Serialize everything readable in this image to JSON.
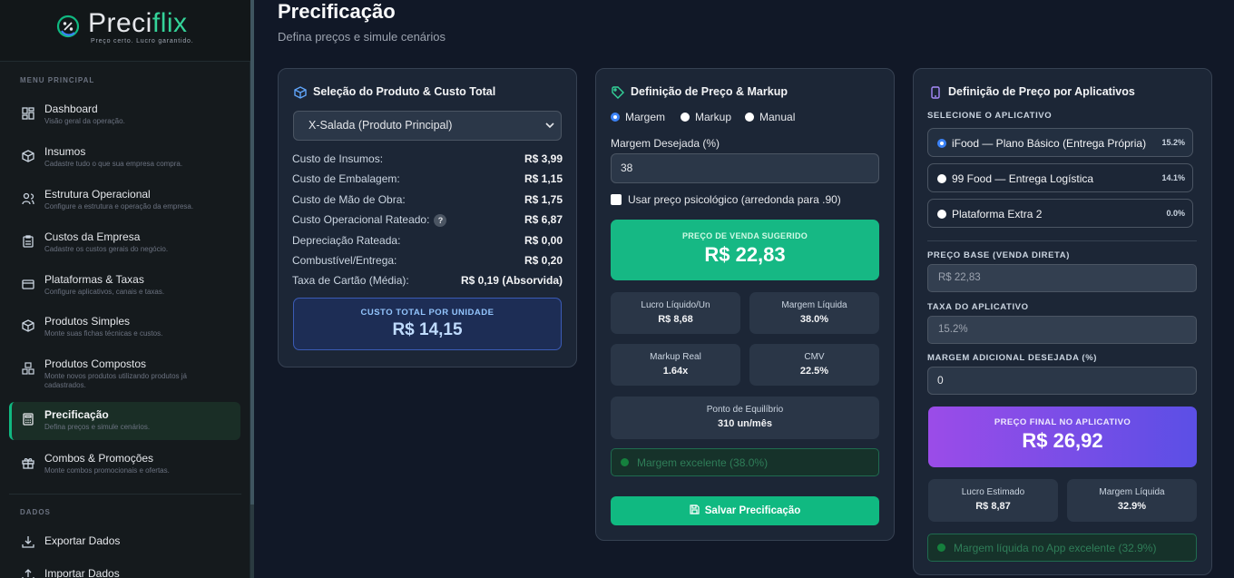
{
  "brand": {
    "name_a": "Preci",
    "name_b": "flix",
    "tagline": "Preço certo. Lucro garantido.",
    "accent": "#10b981"
  },
  "sidebar": {
    "section_main": "MENU PRINCIPAL",
    "section_data": "DADOS",
    "items": [
      {
        "title": "Dashboard",
        "desc": "Visão geral da operação.",
        "icon": "dashboard-icon"
      },
      {
        "title": "Insumos",
        "desc": "Cadastre tudo o que sua empresa compra.",
        "icon": "cube-icon"
      },
      {
        "title": "Estrutura Operacional",
        "desc": "Configure a estrutura e operação da empresa.",
        "icon": "people-icon"
      },
      {
        "title": "Custos da Empresa",
        "desc": "Cadastre os custos gerais do negócio.",
        "icon": "clipboard-icon"
      },
      {
        "title": "Plataformas & Taxas",
        "desc": "Configure aplicativos, canais e taxas.",
        "icon": "card-icon"
      },
      {
        "title": "Produtos Simples",
        "desc": "Monte suas fichas técnicas e custos.",
        "icon": "box-icon"
      },
      {
        "title": "Produtos Compostos",
        "desc": "Monte novos produtos utilizando produtos já cadastrados.",
        "icon": "boxes-icon"
      },
      {
        "title": "Precificação",
        "desc": "Defina preços e simule cenários.",
        "icon": "calculator-icon",
        "active": true
      },
      {
        "title": "Combos & Promoções",
        "desc": "Monte combos promocionais e ofertas.",
        "icon": "gift-icon"
      }
    ],
    "data_items": [
      {
        "title": "Exportar Dados",
        "icon": "download-icon"
      },
      {
        "title": "Importar Dados",
        "icon": "upload-icon"
      }
    ]
  },
  "page": {
    "title": "Precificação",
    "subtitle": "Defina preços e simule cenários"
  },
  "product_card": {
    "title": "Seleção do Produto & Custo Total",
    "selected_product": "X-Salada (Produto Principal)",
    "rows": [
      {
        "label": "Custo de Insumos:",
        "value": "R$ 3,99"
      },
      {
        "label": "Custo de Embalagem:",
        "value": "R$ 1,15"
      },
      {
        "label": "Custo de Mão de Obra:",
        "value": "R$ 1,75"
      },
      {
        "label": "Custo Operacional Rateado:",
        "value": "R$ 6,87",
        "help": "?"
      },
      {
        "label": "Depreciação Rateada:",
        "value": "R$ 0,00"
      },
      {
        "label": "Combustível/Entrega:",
        "value": "R$ 0,20"
      },
      {
        "label": "Taxa de Cartão (Média):",
        "value": "R$ 0,19 (Absorvida)"
      }
    ],
    "total_label": "CUSTO TOTAL POR UNIDADE",
    "total_value": "R$ 14,15"
  },
  "markup_card": {
    "title": "Definição de Preço & Markup",
    "modes": [
      "Margem",
      "Markup",
      "Manual"
    ],
    "selected_mode": "Margem",
    "margin_label": "Margem Desejada (%)",
    "margin_value": "38",
    "psych_label": "Usar preço psicológico (arredonda para .90)",
    "psych_checked": false,
    "suggested_label": "PREÇO DE VENDA SUGERIDO",
    "suggested_value": "R$ 22,83",
    "metrics": [
      {
        "label": "Lucro Líquido/Un",
        "value": "R$ 8,68"
      },
      {
        "label": "Margem Líquida",
        "value": "38.0%"
      },
      {
        "label": "Markup Real",
        "value": "1.64x"
      },
      {
        "label": "CMV",
        "value": "22.5%"
      }
    ],
    "breakeven_label": "Ponto de Equilíbrio",
    "breakeven_value": "310 un/mês",
    "status": "Margem excelente (38.0%)",
    "save_label": "Salvar Precificação"
  },
  "apps_card": {
    "title": "Definição de Preço por Aplicativos",
    "select_label": "SELECIONE O APLICATIVO",
    "apps": [
      {
        "name": "iFood — Plano Básico (Entrega Própria)",
        "pct": "15.2%",
        "selected": true
      },
      {
        "name": "99 Food — Entrega Logística",
        "pct": "14.1%",
        "selected": false
      },
      {
        "name": "Plataforma Extra 2",
        "pct": "0.0%",
        "selected": false
      }
    ],
    "base_label": "PREÇO BASE (VENDA DIRETA)",
    "base_value": "R$ 22,83",
    "fee_label": "TAXA DO APLICATIVO",
    "fee_value": "15.2%",
    "extra_label": "MARGEM ADICIONAL DESEJADA (%)",
    "extra_value": "0",
    "final_label": "PREÇO FINAL NO APLICATIVO",
    "final_value": "R$ 26,92",
    "metrics": [
      {
        "label": "Lucro Estimado",
        "value": "R$ 8,87"
      },
      {
        "label": "Margem Líquida",
        "value": "32.9%"
      }
    ],
    "status": "Margem líquida no App excelente (32.9%)"
  }
}
